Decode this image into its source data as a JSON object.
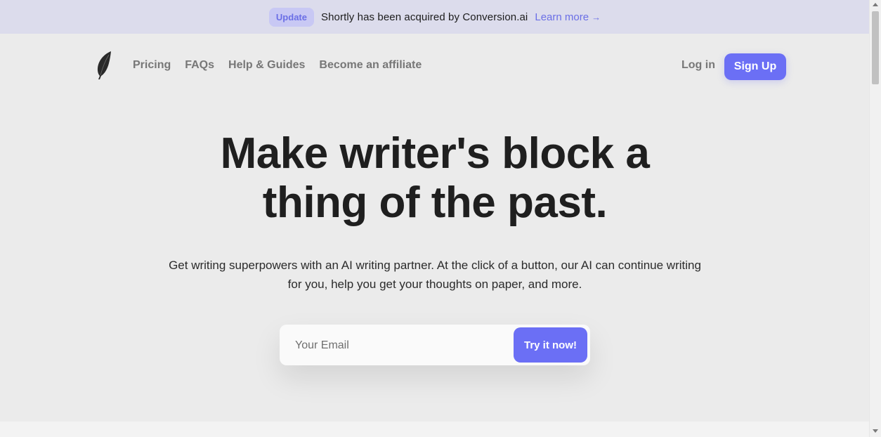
{
  "announcement": {
    "badge": "Update",
    "text": "Shortly has been acquired by Conversion.ai",
    "link_label": "Learn more",
    "link_icon": "arrow-right-icon",
    "arrow_glyph": "→"
  },
  "nav": {
    "logo_icon": "feather-icon",
    "links": [
      {
        "label": "Pricing"
      },
      {
        "label": "FAQs"
      },
      {
        "label": "Help & Guides"
      },
      {
        "label": "Become an affiliate"
      }
    ],
    "login_label": "Log in",
    "signup_label": "Sign Up"
  },
  "hero": {
    "title_line1": "Make writer's block a",
    "title_line2": "thing of the past.",
    "subtitle": "Get writing superpowers with an AI writing partner. At the click of a button, our AI can continue writing for you, help you get your thoughts on paper, and more."
  },
  "signup_form": {
    "email_placeholder": "Your Email",
    "email_value": "",
    "submit_label": "Try it now!"
  },
  "colors": {
    "accent": "#6b6ff5",
    "announce_bg": "#dcdcec",
    "page_bg": "#ebebeb",
    "heading": "#1f1f1f",
    "nav_text": "#777777"
  }
}
